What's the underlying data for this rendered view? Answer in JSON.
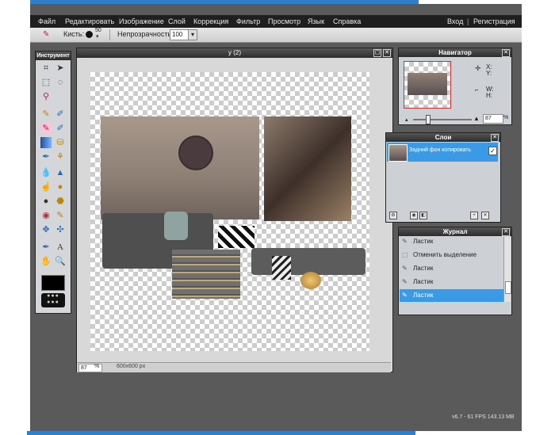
{
  "menu": {
    "items": [
      "Файл",
      "Редактировать",
      "Изображение",
      "Слой",
      "Коррекция",
      "Фильтр",
      "Просмотр",
      "Язык",
      "Справка"
    ],
    "login": "Вход",
    "separator": "|",
    "register": "Регистрация"
  },
  "toolbar": {
    "brush_label": "Кисть:",
    "brush_size": "50",
    "opacity_label": "Непрозрачность:",
    "opacity_value": "100"
  },
  "tools_panel": {
    "title": "Инструмент"
  },
  "document": {
    "title": "у (2)",
    "zoom": "87",
    "zoom_unit": "%",
    "size": "600x600 px"
  },
  "navigator": {
    "title": "Навигатор",
    "x_label": "X:",
    "y_label": "Y:",
    "w_label": "W:",
    "h_label": "H:",
    "zoom": "87",
    "zoom_unit": "%"
  },
  "layers": {
    "title": "Слои",
    "items": [
      {
        "name": "Задний фон копировать",
        "checked": true
      }
    ]
  },
  "journal": {
    "title": "Журнал",
    "items": [
      "Ластик",
      "Отменить выделение",
      "Ластик",
      "Ластик",
      "Ластик"
    ],
    "selected_index": 4
  },
  "status": {
    "text": "v6.7 - 61 FPS 143.13 MB"
  },
  "colors": {
    "accent": "#3a9ae6",
    "menubar": "#1f1f1f",
    "workspace": "#5a5a5a"
  }
}
